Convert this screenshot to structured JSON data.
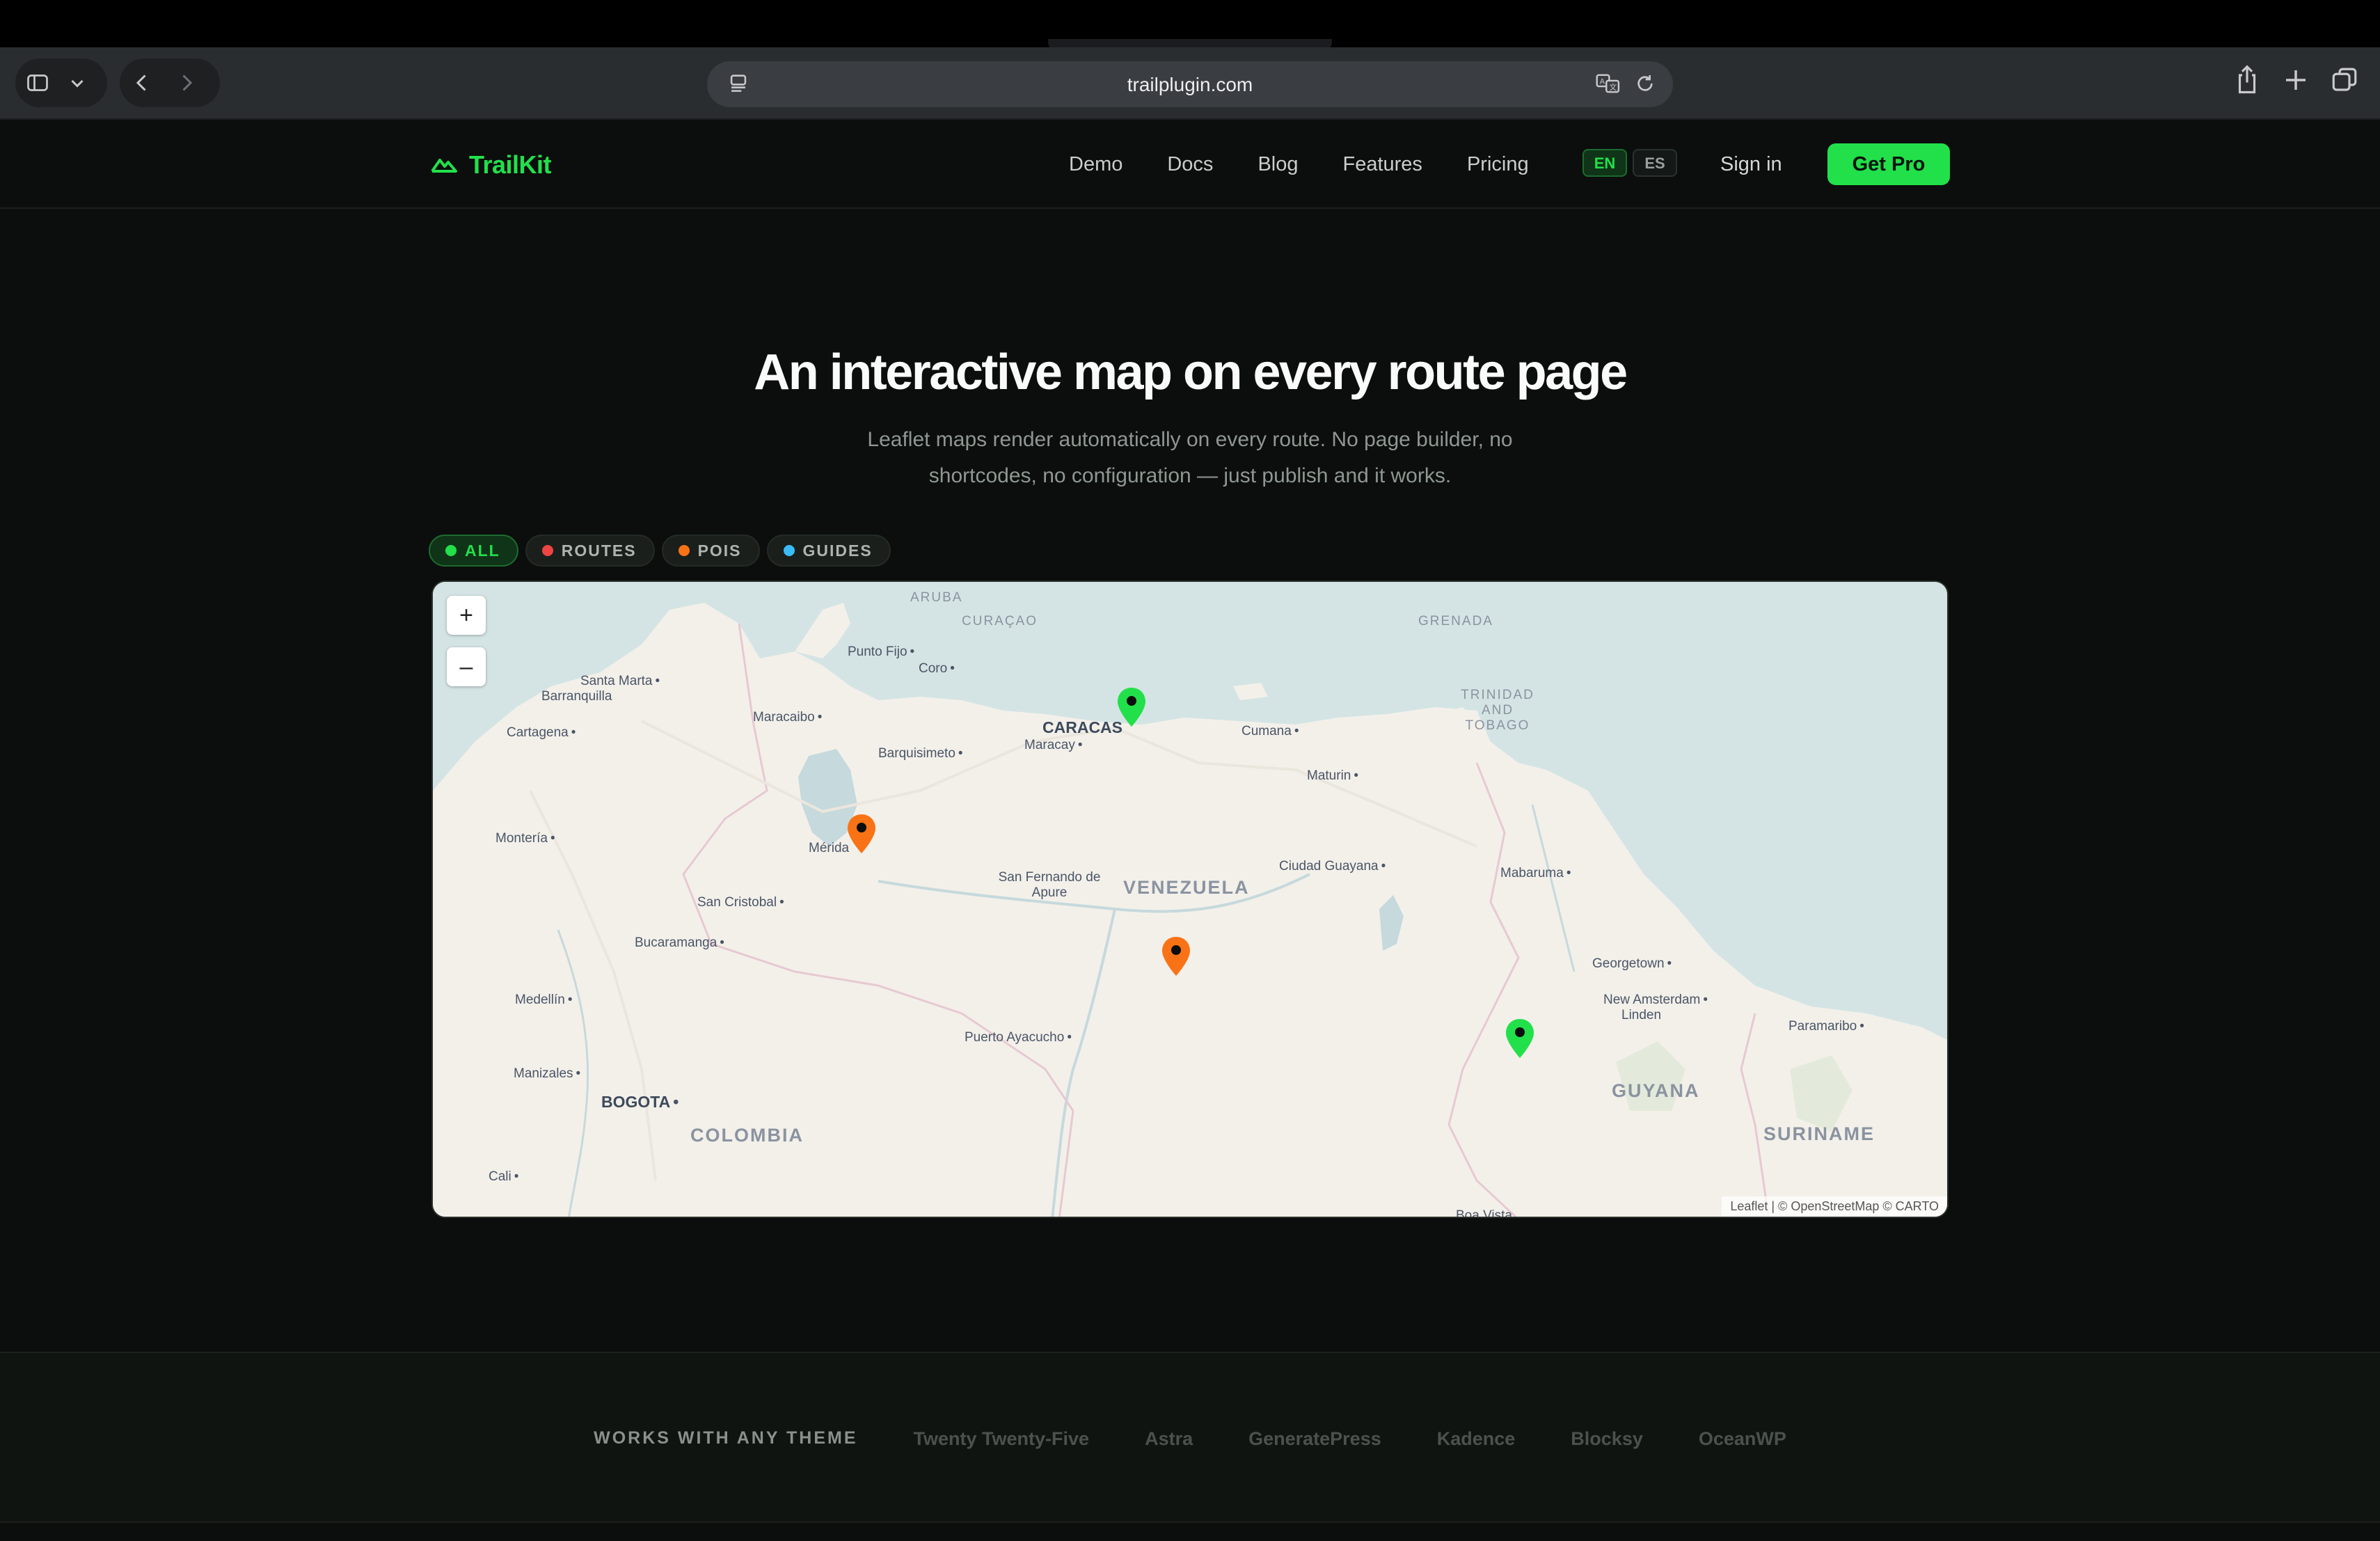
{
  "browser": {
    "url": "trailplugin.com"
  },
  "header": {
    "logo": "TrailKit",
    "nav": [
      "Demo",
      "Docs",
      "Blog",
      "Features",
      "Pricing"
    ],
    "lang": [
      "EN",
      "ES"
    ],
    "signin": "Sign in",
    "cta": "Get Pro"
  },
  "hero": {
    "title": "An interactive map on every route page",
    "subtitle": "Leaflet maps render automatically on every route. No page builder, no shortcodes, no configuration — just publish and it works."
  },
  "filters": [
    {
      "label": "ALL",
      "color": "#22e04a"
    },
    {
      "label": "ROUTES",
      "color": "#ef4444"
    },
    {
      "label": "POIS",
      "color": "#f97316"
    },
    {
      "label": "GUIDES",
      "color": "#38bdf8"
    }
  ],
  "map": {
    "zoom_in": "+",
    "zoom_out": "–",
    "attribution": "Leaflet | © OpenStreetMap © CARTO",
    "labels": {
      "aruba": "ARUBA",
      "curacao": "CURAÇAO",
      "grenada": "GRENADA",
      "trinidad": "TRINIDAD AND TOBAGO",
      "punto_fijo": "Punto Fijo",
      "coro": "Coro",
      "santa_marta": "Santa Marta",
      "barranquilla": "Barranquilla",
      "maracaibo": "Maracaibo",
      "cartagena": "Cartagena",
      "barquisimeto": "Barquisimeto",
      "caracas": "CARACAS",
      "maracay": "Maracay",
      "cumana": "Cumana",
      "maturin": "Maturin",
      "monteria": "Montería",
      "merida": "Mérida",
      "ciudad_guayana": "Ciudad Guayana",
      "mabaruma": "Mabaruma",
      "san_fernando": "San Fernando de Apure",
      "venezuela": "VENEZUELA",
      "san_cristobal": "San Cristobal",
      "bucaramanga": "Bucaramanga",
      "georgetown": "Georgetown",
      "medellin": "Medellín",
      "new_amsterdam": "New Amsterdam",
      "linden": "Linden",
      "paramaribo": "Paramaribo",
      "puerto_ayacucho": "Puerto Ayacucho",
      "manizales": "Manizales",
      "guyana": "GUYANA",
      "bogota": "BOGOTA",
      "colombia": "COLOMBIA",
      "suriname": "SURINAME",
      "cali": "Cali",
      "boa_vista": "Boa Vista"
    },
    "markers": [
      {
        "type": "route",
        "color": "#22e04a"
      },
      {
        "type": "poi",
        "color": "#f97316"
      },
      {
        "type": "poi",
        "color": "#f97316"
      },
      {
        "type": "route",
        "color": "#22e04a"
      }
    ]
  },
  "themes": {
    "label": "WORKS WITH ANY THEME",
    "items": [
      "Twenty Twenty-Five",
      "Astra",
      "GeneratePress",
      "Kadence",
      "Blocksy",
      "OceanWP"
    ]
  }
}
